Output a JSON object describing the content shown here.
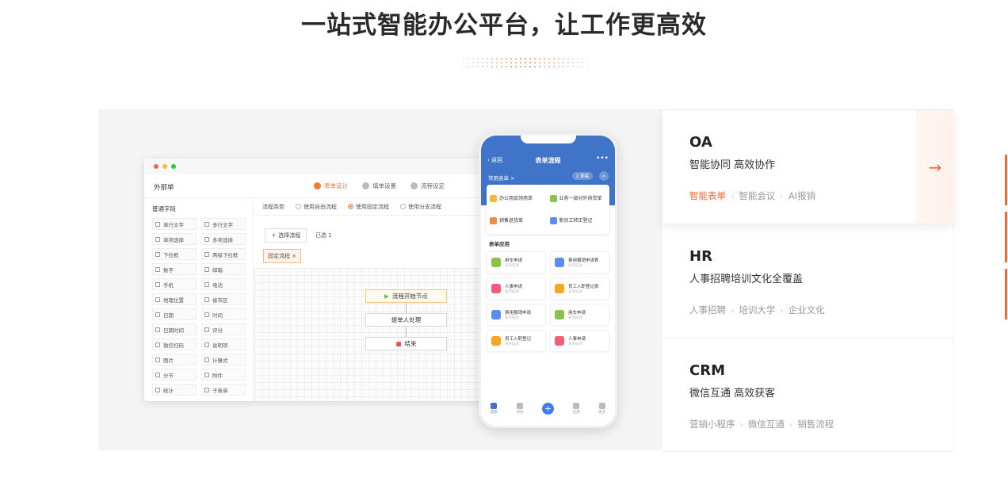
{
  "headline": "一站式智能办公平台，让工作更高效",
  "illustration": {
    "desktop": {
      "window_title": "外部单",
      "steps": [
        "表单设计",
        "填单设置",
        "流程设定"
      ],
      "left_panel_title": "普通字段",
      "fields": [
        "单行文字",
        "多行文字",
        "单项选择",
        "多项选择",
        "下拉框",
        "两级下拉框",
        "数字",
        "邮箱",
        "手机",
        "电话",
        "地理位置",
        "省市区",
        "日期",
        "时间",
        "日期时间",
        "评分",
        "微信扫码",
        "说明项",
        "图片",
        "计算式",
        "分节",
        "附件",
        "统计",
        "子表单"
      ],
      "flow_type_label": "流程类型",
      "flow_options": [
        "使用自由流程",
        "使用固定流程",
        "使用分支流程"
      ],
      "select_flow_button": "选择流程",
      "selected_text": "已选 1",
      "tag": "固定流程",
      "nodes": [
        "流程开始节点",
        "提单人处理",
        "结束"
      ]
    },
    "phone": {
      "title": "表单流程",
      "back": "返回",
      "sub": "常用表单 >",
      "pill": "2 草稿",
      "quick": [
        "办公用品领用单",
        "业务一部对外供货单",
        "销售退货单",
        "新员工转正登记"
      ],
      "apps_title": "表单应用",
      "apps": [
        {
          "name": "用车申请",
          "sub": "表单描述",
          "color": "#8bc34a"
        },
        {
          "name": "费用报销申请表",
          "sub": "表单描述",
          "color": "#5b8def"
        },
        {
          "name": "人事申请",
          "sub": "表单描述",
          "color": "#f25c7a"
        },
        {
          "name": "员工入职登记表",
          "sub": "表单描述",
          "color": "#f5a623"
        },
        {
          "name": "费用报销申请",
          "sub": "表单描述",
          "color": "#5b8def"
        },
        {
          "name": "用车申请",
          "sub": "表单描述",
          "color": "#8bc34a"
        },
        {
          "name": "员工入职登记",
          "sub": "表单描述",
          "color": "#f5a623"
        },
        {
          "name": "人事申请",
          "sub": "表单描述",
          "color": "#f25c7a"
        }
      ],
      "tabs": [
        "首页",
        "消息",
        "",
        "应用",
        "更多"
      ]
    }
  },
  "products": [
    {
      "name": "OA",
      "desc": "智能协同 高效协作",
      "links": [
        "智能表单",
        "智能会议",
        "AI报销"
      ]
    },
    {
      "name": "HR",
      "desc": "人事招聘培训文化全覆盖",
      "links": [
        "人事招聘",
        "培训大学",
        "企业文化"
      ]
    },
    {
      "name": "CRM",
      "desc": "微信互通 高效获客",
      "links": [
        "营销小程序",
        "微信互通",
        "销售流程"
      ]
    }
  ],
  "colors": {
    "accent": "#f06a32",
    "phone_header": "#3f74c9"
  },
  "icons": {
    "arrow": "arrow-right-icon"
  }
}
